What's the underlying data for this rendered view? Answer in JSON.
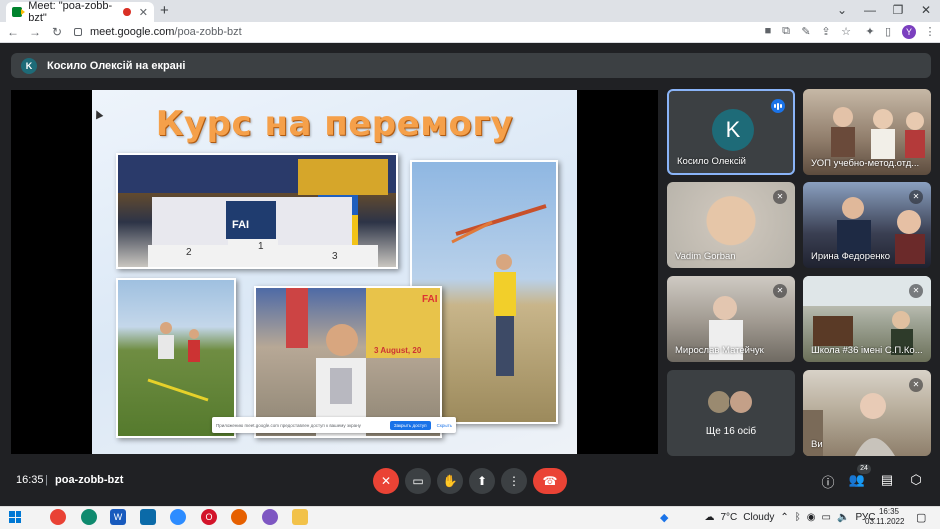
{
  "browser": {
    "tab_title": "Meet: \"poa-zobb-bzt\"",
    "tab_close": "✕",
    "new_tab": "+",
    "url_host": "meet.google.com",
    "url_path": "/poa-zobb-bzt",
    "profile_initial": "Y",
    "window_controls": [
      "⌄",
      "—",
      "❐",
      "✕"
    ]
  },
  "presenting_bar": {
    "avatar_initial": "K",
    "text": "Косило Олексій на екрані"
  },
  "slide": {
    "title": "Курс на перемогу",
    "podium_numbers": [
      "2",
      "1",
      "3"
    ],
    "fai_label": "FAI",
    "date_text": "3 August, 20",
    "share_notice": {
      "text": "Приложению meet.google.com предоставлен доступ к вашему экрану",
      "stop_button": "Закрыть доступ",
      "hide_button": "Скрыть"
    }
  },
  "participants": [
    {
      "name": "Косило Олексій",
      "initial": "K",
      "state": "speaking"
    },
    {
      "name": "УОП учебно-метод.отд...",
      "state": "video"
    },
    {
      "name": "Vadim Gorban",
      "state": "muted"
    },
    {
      "name": "Ирина Федоренко",
      "state": "muted"
    },
    {
      "name": "Мирослав Матейчук",
      "state": "muted"
    },
    {
      "name": "Школа #36 імені С.П.Ко...",
      "state": "muted"
    },
    {
      "name": "Ще 16 осіб",
      "state": "more"
    },
    {
      "name": "Ви",
      "state": "muted"
    }
  ],
  "controls": {
    "time": "16:35",
    "separator": "|",
    "meeting_code": "poa-zobb-bzt",
    "participant_count": "24"
  },
  "taskbar": {
    "temperature": "7°C",
    "weather": "Cloudy",
    "language": "РУС",
    "time": "16:35",
    "date": "03.11.2022"
  },
  "colors": {
    "meet_bg": "#202124",
    "tile_bg": "#3c4043",
    "danger": "#ea4335",
    "accent": "#1a73e8",
    "title_orange": "#f5a04a"
  }
}
